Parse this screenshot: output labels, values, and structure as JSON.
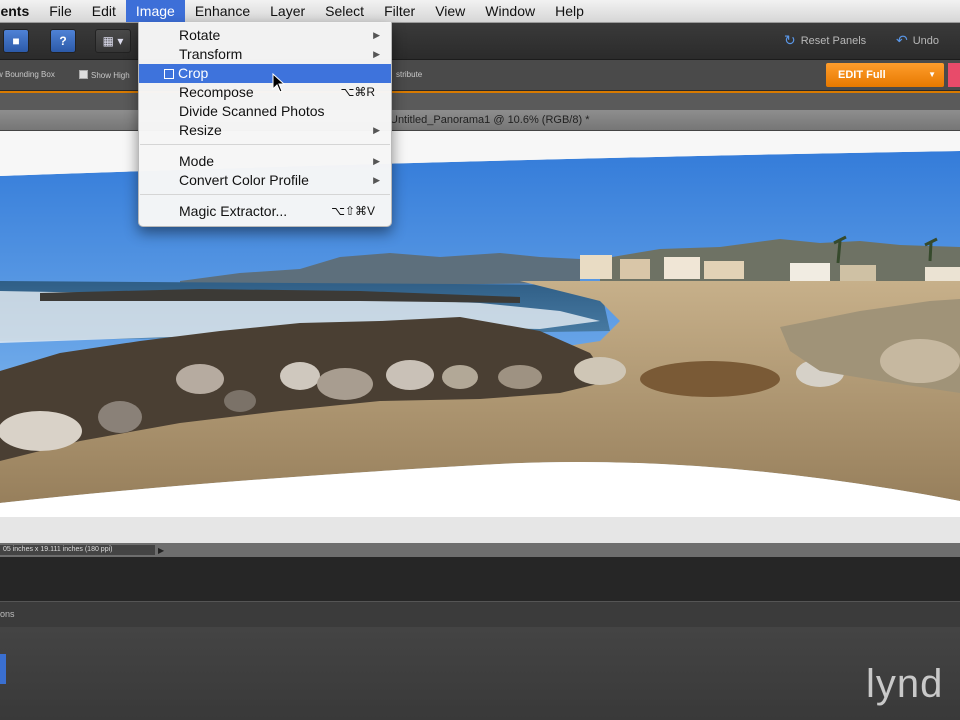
{
  "menubar": {
    "items": [
      "ments",
      "File",
      "Edit",
      "Image",
      "Enhance",
      "Layer",
      "Select",
      "Filter",
      "View",
      "Window",
      "Help"
    ],
    "active": "Image"
  },
  "toolbar": {
    "help_label": "?",
    "reset_panels": "Reset Panels",
    "undo": "Undo"
  },
  "options": {
    "bounding_box": "w Bounding Box",
    "show_highlight": "Show High",
    "distribute": "stribute",
    "edit_mode": "EDIT Full"
  },
  "image_menu": {
    "rotate": "Rotate",
    "transform": "Transform",
    "crop": "Crop",
    "recompose": "Recompose",
    "recompose_shortcut": "⌥⌘R",
    "divide": "Divide Scanned Photos",
    "resize": "Resize",
    "mode": "Mode",
    "convert": "Convert Color Profile",
    "magic": "Magic Extractor...",
    "magic_shortcut": "⌥⇧⌘V"
  },
  "document": {
    "title": "Untitled_Panorama1 @ 10.6% (RGB/8) *",
    "status": "05 inches x 19.111 inches (180 ppi)"
  },
  "bin_label": "ions",
  "watermark": "lynd",
  "colors": {
    "menu_highlight": "#3e73dc",
    "edit_button": "#f08800",
    "accent_rule": "#d87a00"
  }
}
